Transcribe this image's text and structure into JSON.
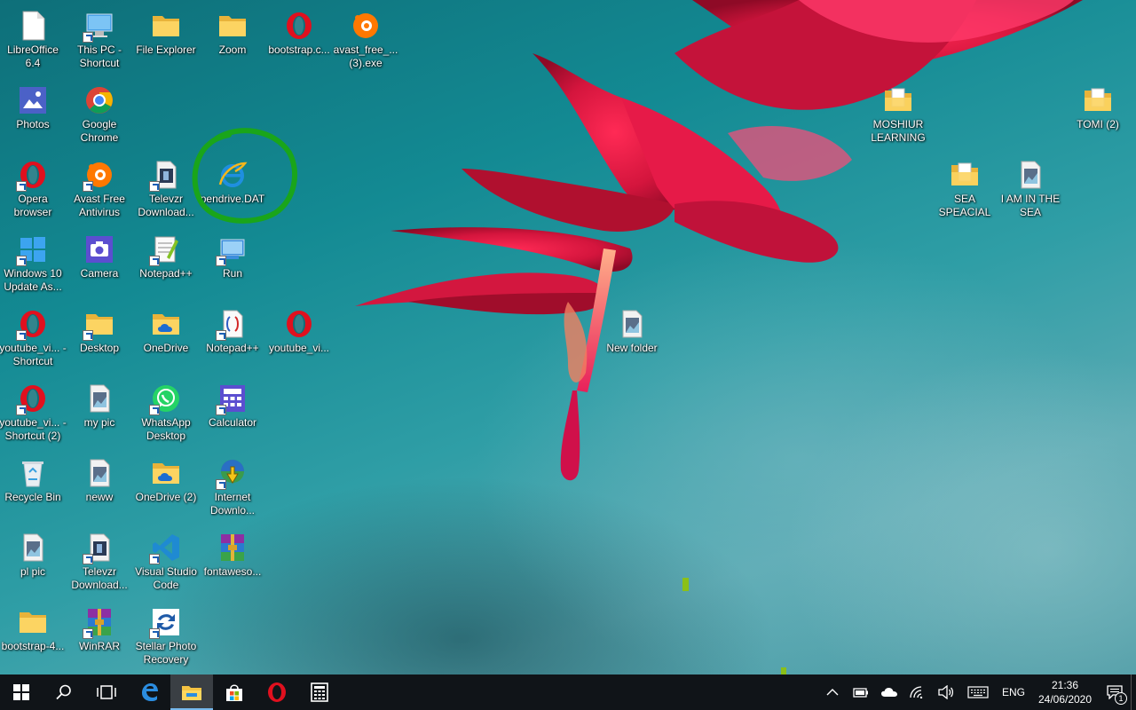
{
  "desktop": {
    "icons": [
      {
        "label": "LibreOffice 6.4",
        "icon": "libreoffice-icon",
        "shortcut": false
      },
      {
        "label": "This PC - Shortcut",
        "icon": "this-pc-icon",
        "shortcut": true
      },
      {
        "label": "File Explorer",
        "icon": "folder-icon",
        "shortcut": false
      },
      {
        "label": "Zoom",
        "icon": "folder-icon",
        "shortcut": false
      },
      {
        "label": "bootstrap.c...",
        "icon": "opera-icon",
        "shortcut": false
      },
      {
        "label": "avast_free_... (3).exe",
        "icon": "avast-icon",
        "shortcut": false
      },
      {
        "label": "Photos",
        "icon": "photos-icon",
        "shortcut": false
      },
      {
        "label": "Google Chrome",
        "icon": "chrome-icon",
        "shortcut": false
      },
      {
        "label": "Opera browser",
        "icon": "opera-icon",
        "shortcut": true
      },
      {
        "label": "Avast Free Antivirus",
        "icon": "avast-icon",
        "shortcut": true
      },
      {
        "label": "Televzr Download...",
        "icon": "video-file-icon",
        "shortcut": true
      },
      {
        "label": "pendrive.DAT",
        "icon": "internet-explorer-icon",
        "shortcut": false
      },
      {
        "label": "Windows 10 Update As...",
        "icon": "windows-icon",
        "shortcut": true
      },
      {
        "label": "Camera",
        "icon": "camera-icon",
        "shortcut": false
      },
      {
        "label": "Notepad++",
        "icon": "notepadpp-icon",
        "shortcut": true
      },
      {
        "label": "Run",
        "icon": "run-icon",
        "shortcut": true
      },
      {
        "label": "youtube_vi... - Shortcut",
        "icon": "opera-icon",
        "shortcut": true
      },
      {
        "label": "Desktop",
        "icon": "folder-icon",
        "shortcut": true
      },
      {
        "label": "OneDrive",
        "icon": "onedrive-folder-icon",
        "shortcut": false
      },
      {
        "label": "Notepad++",
        "icon": "notepadpp-file-icon",
        "shortcut": true
      },
      {
        "label": "youtube_vi...",
        "icon": "opera-icon",
        "shortcut": false
      },
      {
        "label": "youtube_vi... - Shortcut (2)",
        "icon": "opera-icon",
        "shortcut": true
      },
      {
        "label": "my pic",
        "icon": "image-file-icon",
        "shortcut": false
      },
      {
        "label": "WhatsApp Desktop",
        "icon": "whatsapp-icon",
        "shortcut": true
      },
      {
        "label": "Calculator",
        "icon": "calculator-icon",
        "shortcut": true
      },
      {
        "label": "Recycle Bin",
        "icon": "recycle-bin-icon",
        "shortcut": false
      },
      {
        "label": "neww",
        "icon": "image-file-icon",
        "shortcut": false
      },
      {
        "label": "OneDrive (2)",
        "icon": "onedrive-folder-icon",
        "shortcut": false
      },
      {
        "label": "Internet Downlo...",
        "icon": "idm-icon",
        "shortcut": true
      },
      {
        "label": "pl pic",
        "icon": "image-file-icon",
        "shortcut": false
      },
      {
        "label": "Televzr Download...",
        "icon": "video-file-icon",
        "shortcut": true
      },
      {
        "label": "Visual Studio Code",
        "icon": "vscode-icon",
        "shortcut": true
      },
      {
        "label": "fontaweso...",
        "icon": "winrar-icon",
        "shortcut": false
      },
      {
        "label": "bootstrap-4...",
        "icon": "folder-icon",
        "shortcut": false
      },
      {
        "label": "WinRAR",
        "icon": "winrar-icon",
        "shortcut": true
      },
      {
        "label": "Stellar Photo Recovery",
        "icon": "stellar-icon",
        "shortcut": true
      },
      {
        "label": "New folder",
        "icon": "image-file-icon",
        "shortcut": false
      },
      {
        "label": "MOSHIUR LEARNING",
        "icon": "folder-file-icon",
        "shortcut": false
      },
      {
        "label": "TOMI (2)",
        "icon": "folder-file-icon",
        "shortcut": false
      },
      {
        "label": "SEA SPEACIAL",
        "icon": "folder-file-icon",
        "shortcut": false
      },
      {
        "label": "I AM IN THE SEA",
        "icon": "image-file-icon",
        "shortcut": false
      }
    ]
  },
  "taskbar": {
    "buttons": [
      {
        "name": "start-button",
        "icon": "windows-logo-icon"
      },
      {
        "name": "search-button",
        "icon": "search-icon"
      },
      {
        "name": "task-view-button",
        "icon": "task-view-icon"
      },
      {
        "name": "edge-button",
        "icon": "edge-icon"
      },
      {
        "name": "file-explorer-button",
        "icon": "folder-icon",
        "active": true
      },
      {
        "name": "store-button",
        "icon": "store-icon"
      },
      {
        "name": "opera-button",
        "icon": "opera-icon"
      },
      {
        "name": "calculator-button",
        "icon": "calculator-icon"
      }
    ],
    "tray": {
      "language": "ENG",
      "time": "21:36",
      "date": "24/06/2020",
      "notification_count": "1"
    }
  },
  "colors": {
    "taskbar": "#101418",
    "annotation": "#1aa51a",
    "accent": "#76b9ed"
  }
}
